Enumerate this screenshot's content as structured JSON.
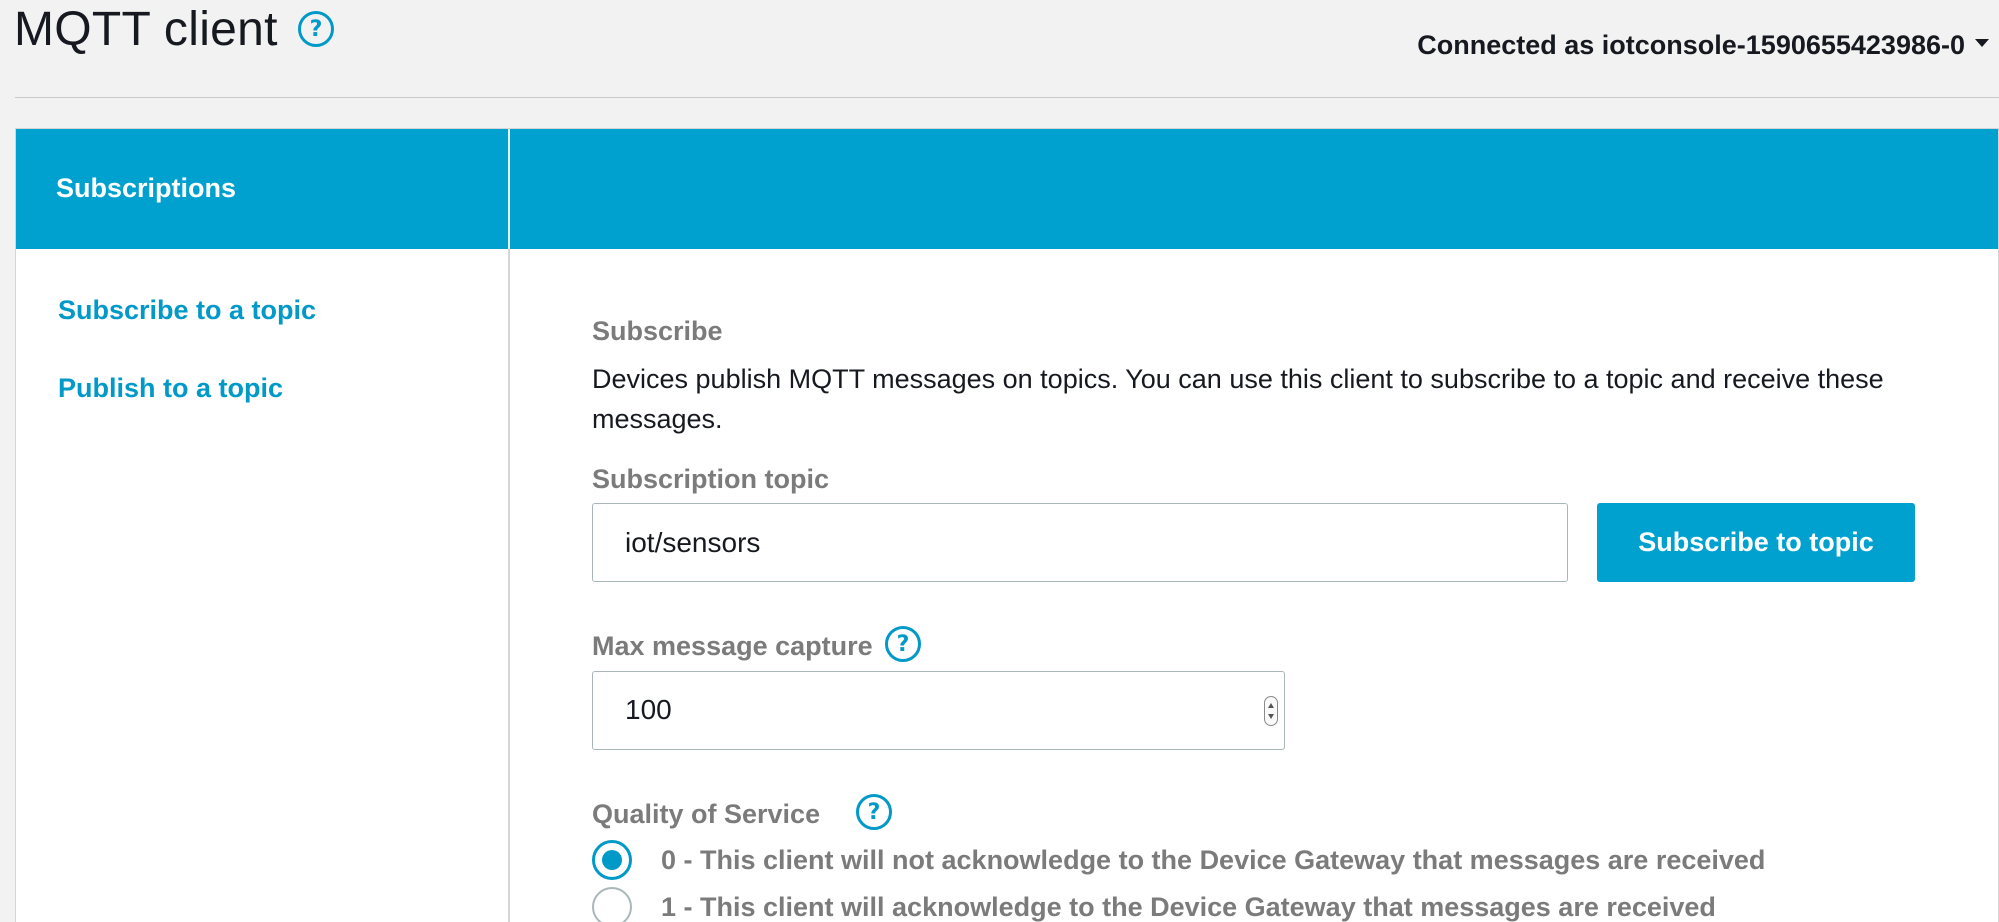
{
  "header": {
    "title": "MQTT client",
    "connection_status": "Connected as iotconsole-1590655423986-0"
  },
  "sidebar": {
    "title": "Subscriptions",
    "items": [
      {
        "label": "Subscribe to a topic"
      },
      {
        "label": "Publish to a topic"
      }
    ]
  },
  "subscribe": {
    "heading": "Subscribe",
    "description": "Devices publish MQTT messages on topics. You can use this client to subscribe to a topic and receive these messages.",
    "topic_label": "Subscription topic",
    "topic_value": "iot/sensors",
    "subscribe_button": "Subscribe to topic",
    "max_capture_label": "Max message capture",
    "max_capture_value": "100",
    "qos_label": "Quality of Service",
    "qos_options": [
      {
        "label": "0 - This client will not acknowledge to the Device Gateway that messages are received",
        "selected": true
      },
      {
        "label": "1 - This client will acknowledge to the Device Gateway that messages are received",
        "selected": false
      }
    ]
  },
  "icons": {
    "help": "help-circle-icon",
    "dropdown": "caret-down-icon"
  },
  "colors": {
    "accent": "#00a1cf",
    "link": "#0099c8",
    "background": "#f2f2f2"
  }
}
